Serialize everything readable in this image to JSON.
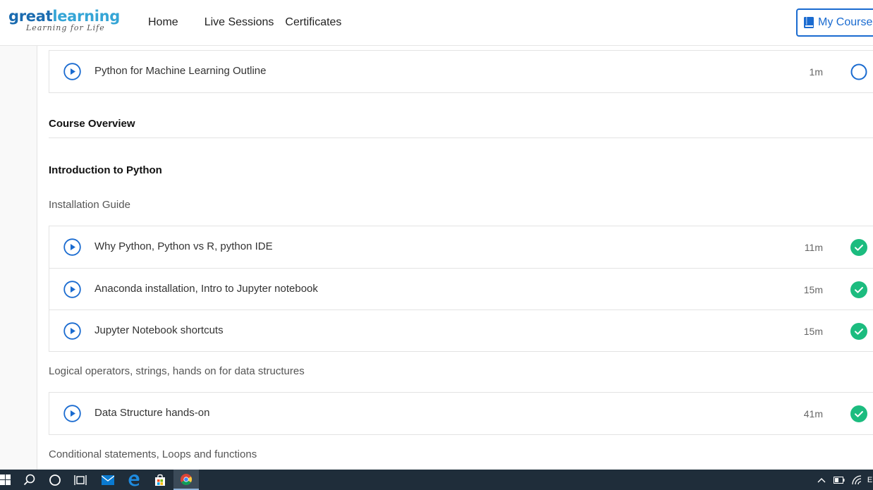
{
  "header": {
    "logo": {
      "main_part1": "great",
      "main_part2": "learning",
      "tagline": "Learning for Life"
    },
    "nav": {
      "home": "Home",
      "live_sessions": "Live Sessions",
      "certificates": "Certificates"
    },
    "my_courses": "My Courses"
  },
  "colors": {
    "brand_blue": "#1a6bd0",
    "complete_green": "#1cbc7f",
    "text": "#333333"
  },
  "outline_row": {
    "title": "Python for Machine Learning Outline",
    "duration": "1m",
    "status": "incomplete"
  },
  "course_overview": "Course Overview",
  "section": {
    "title": "Introduction to Python",
    "groups": [
      {
        "name": "Installation Guide",
        "items": [
          {
            "title": "Why Python, Python vs R, python IDE",
            "duration": "11m",
            "status": "complete"
          },
          {
            "title": "Anaconda installation, Intro to Jupyter notebook",
            "duration": "15m",
            "status": "complete"
          },
          {
            "title": "Jupyter Notebook shortcuts",
            "duration": "15m",
            "status": "complete"
          }
        ]
      },
      {
        "name": "Logical operators, strings, hands on for data structures",
        "items": [
          {
            "title": "Data Structure hands-on",
            "duration": "41m",
            "status": "complete"
          }
        ]
      },
      {
        "name": "Conditional statements, Loops and functions",
        "items": []
      }
    ]
  },
  "taskbar": {
    "icons": [
      "windows-start-icon",
      "search-icon",
      "cortana-icon",
      "task-view-icon",
      "mail-icon",
      "edge-icon",
      "store-icon",
      "chrome-icon"
    ],
    "tray_text": "E"
  }
}
